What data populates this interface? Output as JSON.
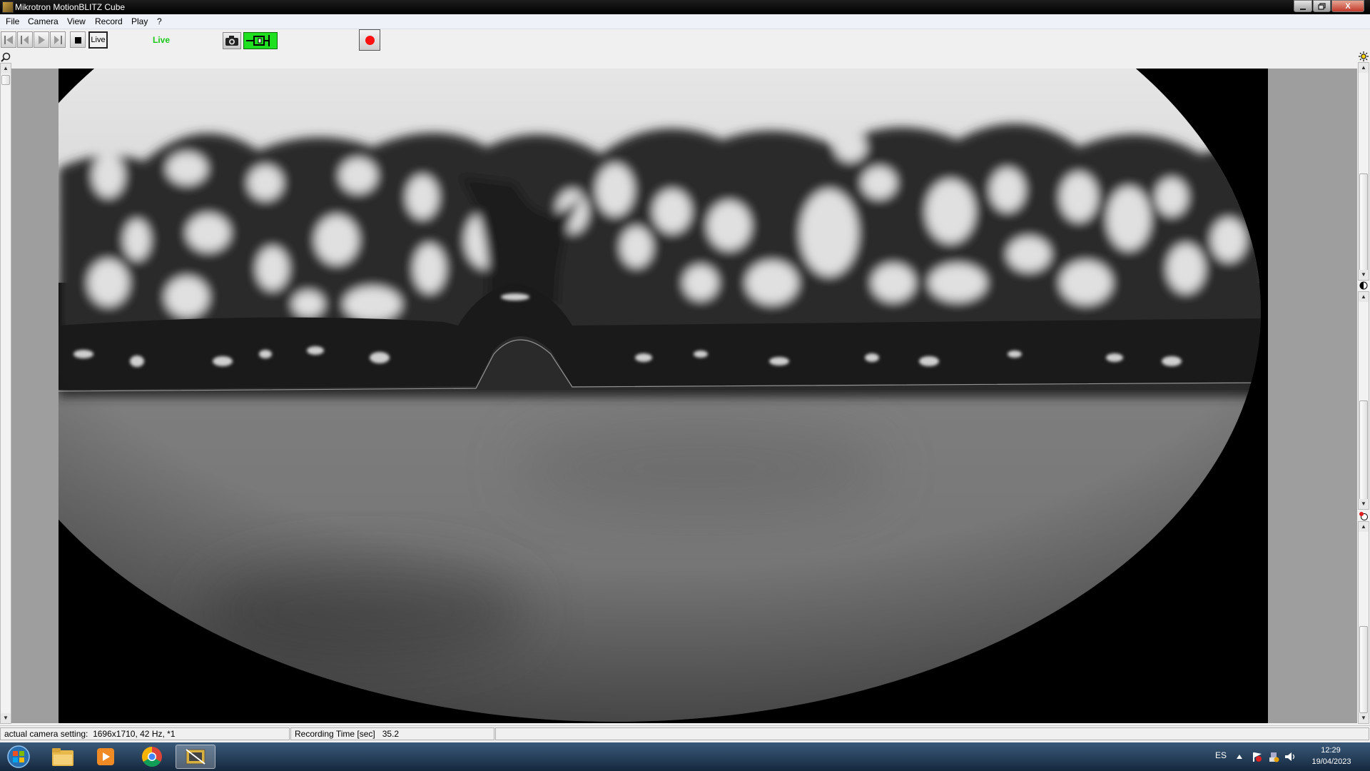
{
  "window": {
    "title": "Mikrotron MotionBLITZ Cube",
    "close_glyph": "X"
  },
  "menu": {
    "items": [
      "File",
      "Camera",
      "View",
      "Record",
      "Play",
      "?"
    ]
  },
  "toolbar": {
    "live_button": "Live",
    "live_status": "Live",
    "live_status_color": "#18c818",
    "trigger_color": "#1ee01e",
    "record_color": "#ff1010"
  },
  "status": {
    "camera_label": "actual camera setting:",
    "camera_value": "1696x1710, 42 Hz, *1",
    "rec_label": "Recording Time [sec]",
    "rec_value": "35.2"
  },
  "taskbar": {
    "language": "ES",
    "time": "12:29",
    "date": "19/04/2023"
  }
}
